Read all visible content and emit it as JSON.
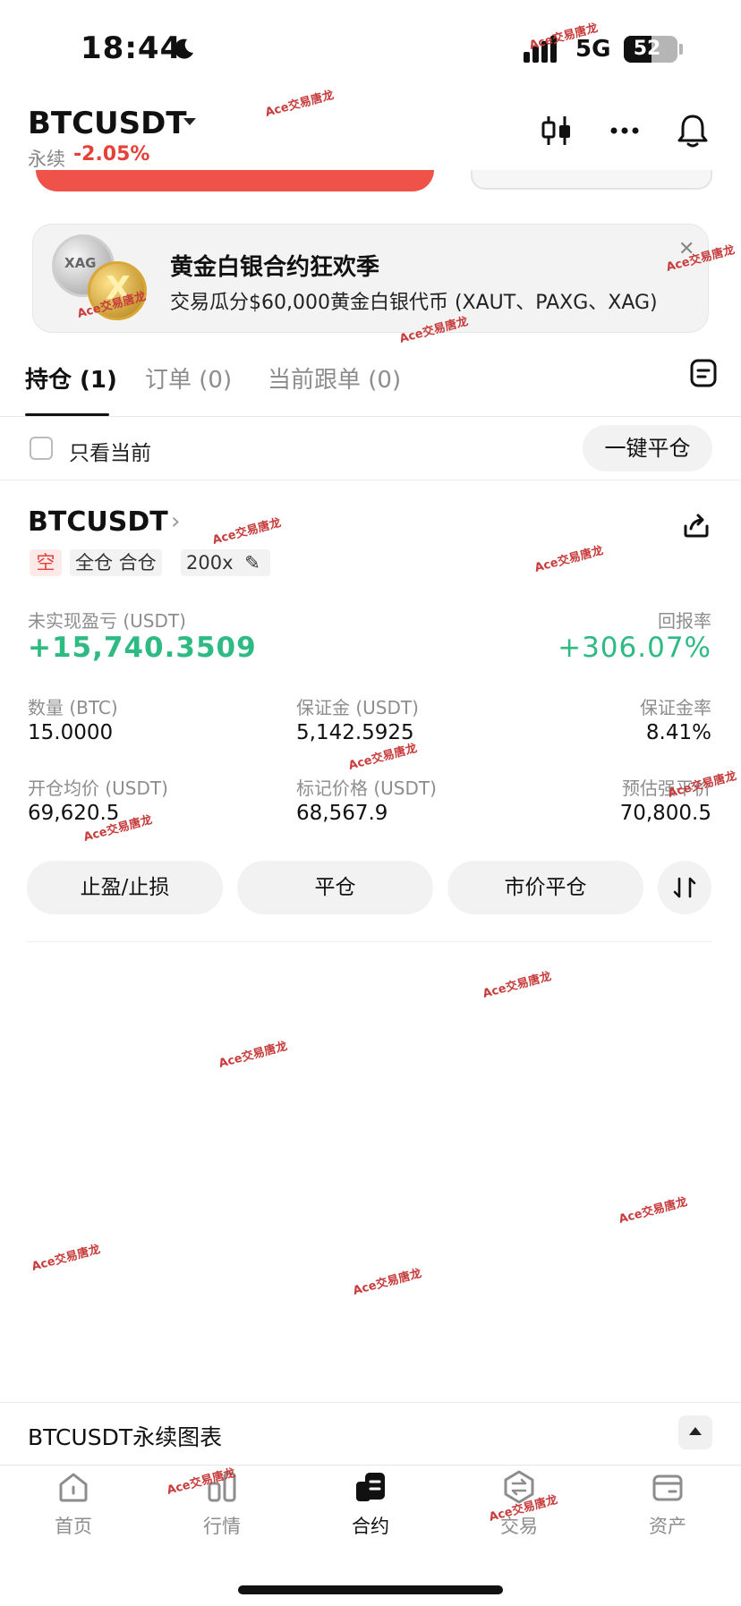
{
  "status_bar": {
    "time": "18:44",
    "network": "5G",
    "battery_level": "52"
  },
  "header": {
    "symbol": "BTCUSDT",
    "contract_type": "永续",
    "change": "-2.05%"
  },
  "banner": {
    "title": "黄金白银合约狂欢季",
    "subtitle": "交易瓜分$60,000黄金白银代币 (XAUT、PAXG、XAG)",
    "coin_label": "XAG"
  },
  "tabs": [
    {
      "label": "持仓 (1)",
      "active": true
    },
    {
      "label": "订单 (0)",
      "active": false
    },
    {
      "label": "当前跟单 (0)",
      "active": false
    }
  ],
  "filter": {
    "only_current_label": "只看当前",
    "close_all_label": "一键平仓"
  },
  "position": {
    "symbol": "BTCUSDT",
    "side": "空",
    "margin_mode": "全仓 合仓",
    "leverage": "200x",
    "unrealized_pnl_label": "未实现盈亏 (USDT)",
    "unrealized_pnl": "+15,740.3509",
    "roe_label": "回报率",
    "roe": "+306.07%",
    "fields": [
      {
        "label": "数量 (BTC)",
        "value": "15.0000"
      },
      {
        "label": "保证金 (USDT)",
        "value": "5,142.5925"
      },
      {
        "label": "保证金率",
        "value": "8.41%"
      },
      {
        "label": "开仓均价 (USDT)",
        "value": "69,620.5"
      },
      {
        "label": "标记价格 (USDT)",
        "value": "68,567.9"
      },
      {
        "label": "预估强平价",
        "value": "70,800.5"
      }
    ],
    "actions": {
      "tpsl": "止盈/止损",
      "close": "平仓",
      "market_close": "市价平仓"
    }
  },
  "chart_bar": {
    "label": "BTCUSDT永续图表"
  },
  "nav": [
    {
      "label": "首页",
      "icon": "home-icon",
      "active": false
    },
    {
      "label": "行情",
      "icon": "market-icon",
      "active": false
    },
    {
      "label": "合约",
      "icon": "futures-icon",
      "active": true
    },
    {
      "label": "交易",
      "icon": "trade-icon",
      "active": false
    },
    {
      "label": "资产",
      "icon": "wallet-icon",
      "active": false
    }
  ],
  "watermark": "Ace交易唐龙",
  "colors": {
    "up": "#2dba83",
    "down": "#e5413b",
    "text": "#111111",
    "muted": "#8d8d8d"
  }
}
